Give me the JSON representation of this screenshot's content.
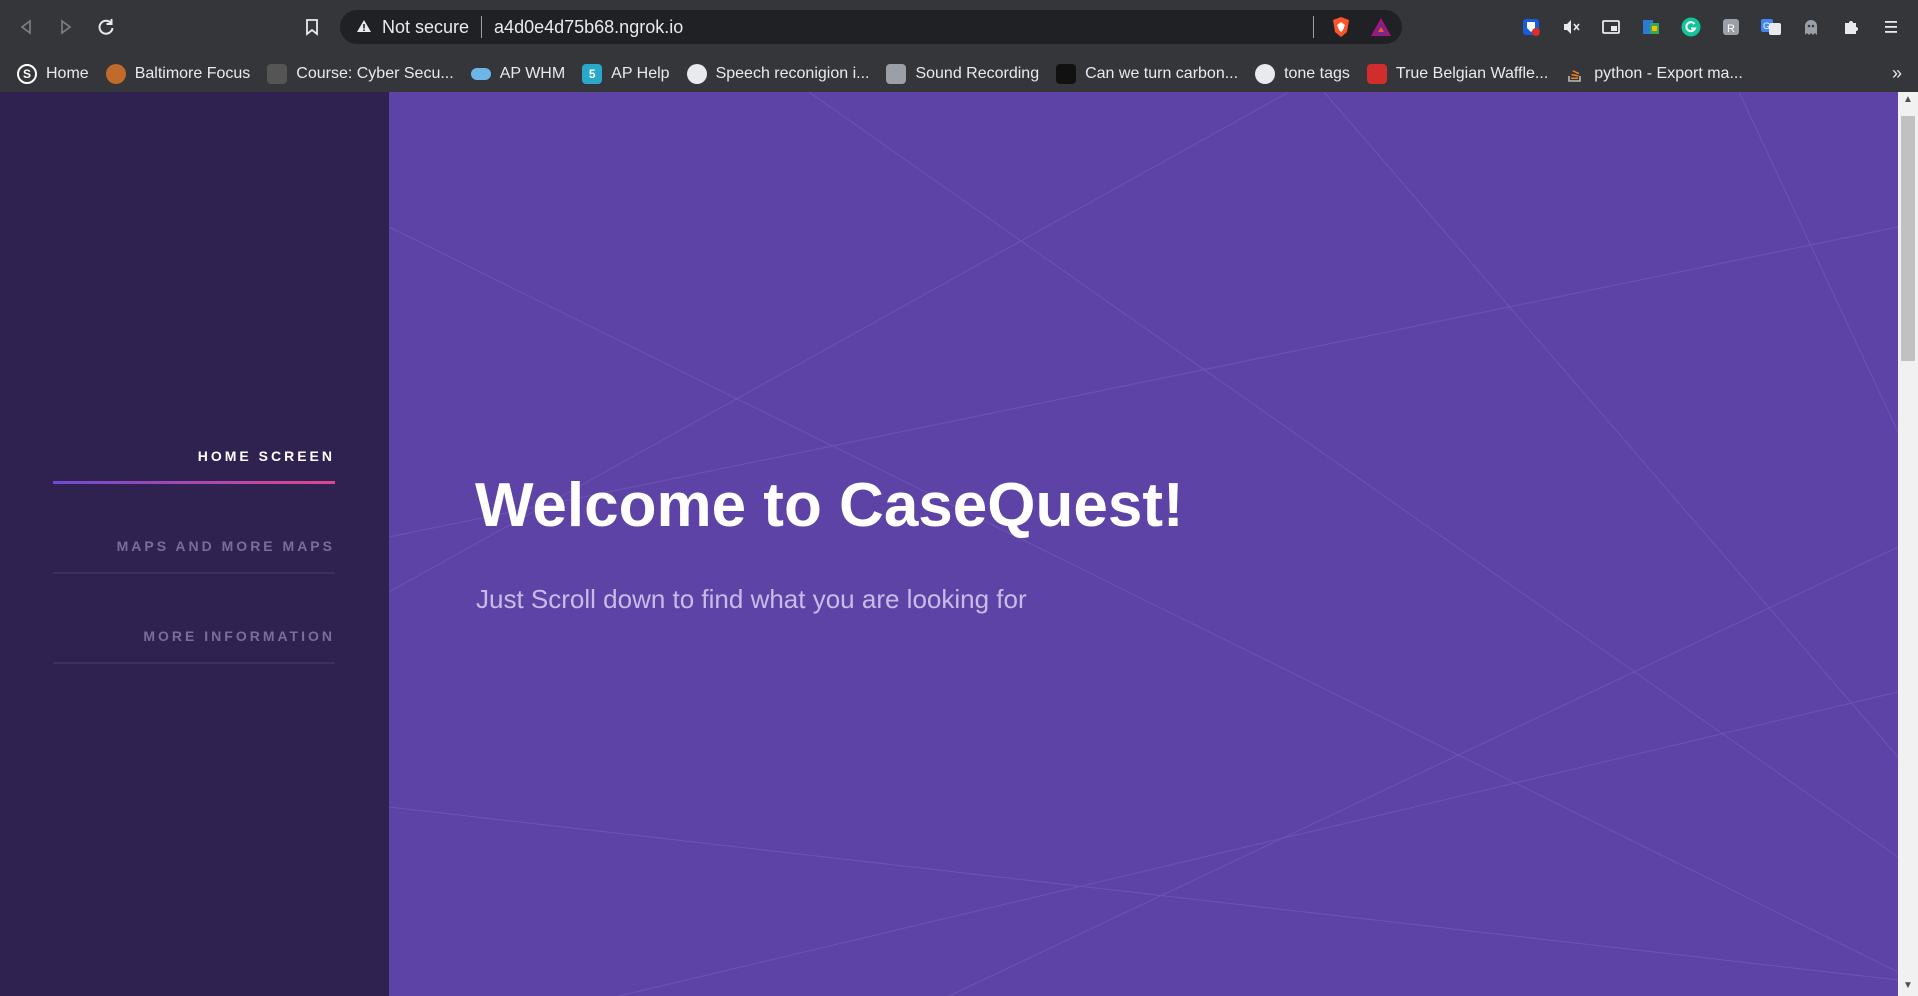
{
  "browser": {
    "security_label": "Not secure",
    "url": "a4d0e4d75b68.ngrok.io",
    "icons": [
      "back-icon",
      "forward-icon",
      "reload-icon",
      "bookmark-icon",
      "warning-icon",
      "brave-shield-icon",
      "brave-rewards-icon"
    ],
    "extensions": [
      "bitwarden-icon",
      "mute-icon",
      "picture-in-picture-icon",
      "sheets-icon",
      "grammarly-icon",
      "reader-icon",
      "translate-icon",
      "ghostery-icon",
      "puzzle-icon",
      "menu-icon"
    ]
  },
  "bookmarks": [
    {
      "label": "Home",
      "icon": "skype-icon",
      "color": "#ffffff"
    },
    {
      "label": "Baltimore Focus",
      "icon": "focus-icon",
      "color": "#c06a2b"
    },
    {
      "label": "Course: Cyber Secu...",
      "icon": "course-icon",
      "color": "#6b6b6b"
    },
    {
      "label": "AP WHM",
      "icon": "cloud-icon",
      "color": "#6fb6e8"
    },
    {
      "label": "AP Help",
      "icon": "five-icon",
      "color": "#2aa8c9"
    },
    {
      "label": "Speech reconigion i...",
      "icon": "python-icon",
      "color": "#e8eaed"
    },
    {
      "label": "Sound Recording",
      "icon": "document-icon",
      "color": "#9aa0a6"
    },
    {
      "label": "Can we turn carbon...",
      "icon": "pawprint-icon",
      "color": "#111111"
    },
    {
      "label": "tone tags",
      "icon": "globe-icon",
      "color": "#e8eaed"
    },
    {
      "label": "True Belgian Waffle...",
      "icon": "waffle-icon",
      "color": "#d12d2d"
    },
    {
      "label": "python - Export ma...",
      "icon": "stackoverflow-icon",
      "color": "#f48024"
    }
  ],
  "sidebar": {
    "items": [
      {
        "label": "HOME SCREEN",
        "active": true
      },
      {
        "label": "MAPS AND MORE MAPS",
        "active": false
      },
      {
        "label": "MORE INFORMATION",
        "active": false
      }
    ]
  },
  "hero": {
    "title": "Welcome to CaseQuest!",
    "subtitle": "Just Scroll down to find what you are looking for"
  },
  "colors": {
    "sidebar_bg": "#2f2250",
    "hero_bg": "#5d43a6",
    "active_text": "#ffffff",
    "inactive_text": "#7b6d9a",
    "accent_gradient_start": "#6d4bd0",
    "accent_gradient_end": "#e0468e"
  }
}
